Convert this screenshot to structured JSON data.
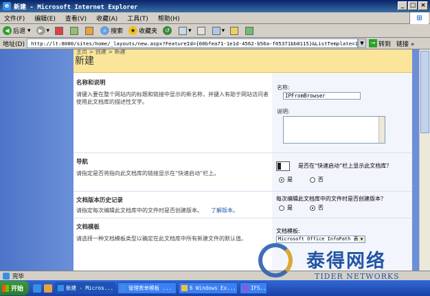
{
  "window": {
    "title": "新建 - Microsoft Internet Explorer",
    "controls": [
      "_",
      "□",
      "×"
    ]
  },
  "menu": [
    "文件(F)",
    "编辑(E)",
    "查看(V)",
    "收藏(A)",
    "工具(T)",
    "帮助(H)"
  ],
  "toolbar": {
    "back": "后退",
    "search": "搜索",
    "favorites": "收藏夹"
  },
  "address": {
    "label": "地址(D)",
    "url": "http://lt:8080/sites/home/_layouts/new.aspx?FeatureId={00bfea71-1e1d-4562-b56a-f05371bb0115}&ListTemplate=115",
    "go": "转到",
    "links": "链接 »"
  },
  "page": {
    "breadcrumb": "主页 > 创建 > 新建",
    "title": "新建"
  },
  "form": {
    "name_section": {
      "heading": "名称和说明",
      "desc": "请键入要在整个网站内的标题和链接中显示的新名称，并键入有助于网站访问者使用此文档库的描述性文字。",
      "name_label": "名称:",
      "name_value": "IPFromBrowser",
      "desc_label": "说明:"
    },
    "nav_section": {
      "heading": "导航",
      "desc": "请指定是否将指向此文档库的链接显示在“快速启动”栏上。",
      "question": "是否在“快速启动”栏上显示此文档库？",
      "yes": "是",
      "no": "否"
    },
    "version_section": {
      "heading": "文档版本历史记录",
      "desc": "请指定每次编辑此文档库中的文件时是否创建版本。",
      "learn_more": "了解版本。",
      "question": "每次编辑此文档库中的文件时是否创建版本？",
      "yes": "是",
      "no": "否"
    },
    "template_section": {
      "heading": "文档模板",
      "desc": "请选择一种文档模板类型以确定在此文档库中所有新建文件的默认值。",
      "label": "文档模板:",
      "value": "Microsoft Office InfoPath 表单"
    }
  },
  "status": {
    "text": "完毕"
  },
  "taskbar": {
    "start": "开始",
    "tasks": [
      "新建 - Micros...",
      "管理表单模板 ...",
      "6 Windows Ex...",
      "IFS..."
    ]
  },
  "watermark": {
    "cn": "泰得网络",
    "en": "TIDER NETWORKS"
  }
}
